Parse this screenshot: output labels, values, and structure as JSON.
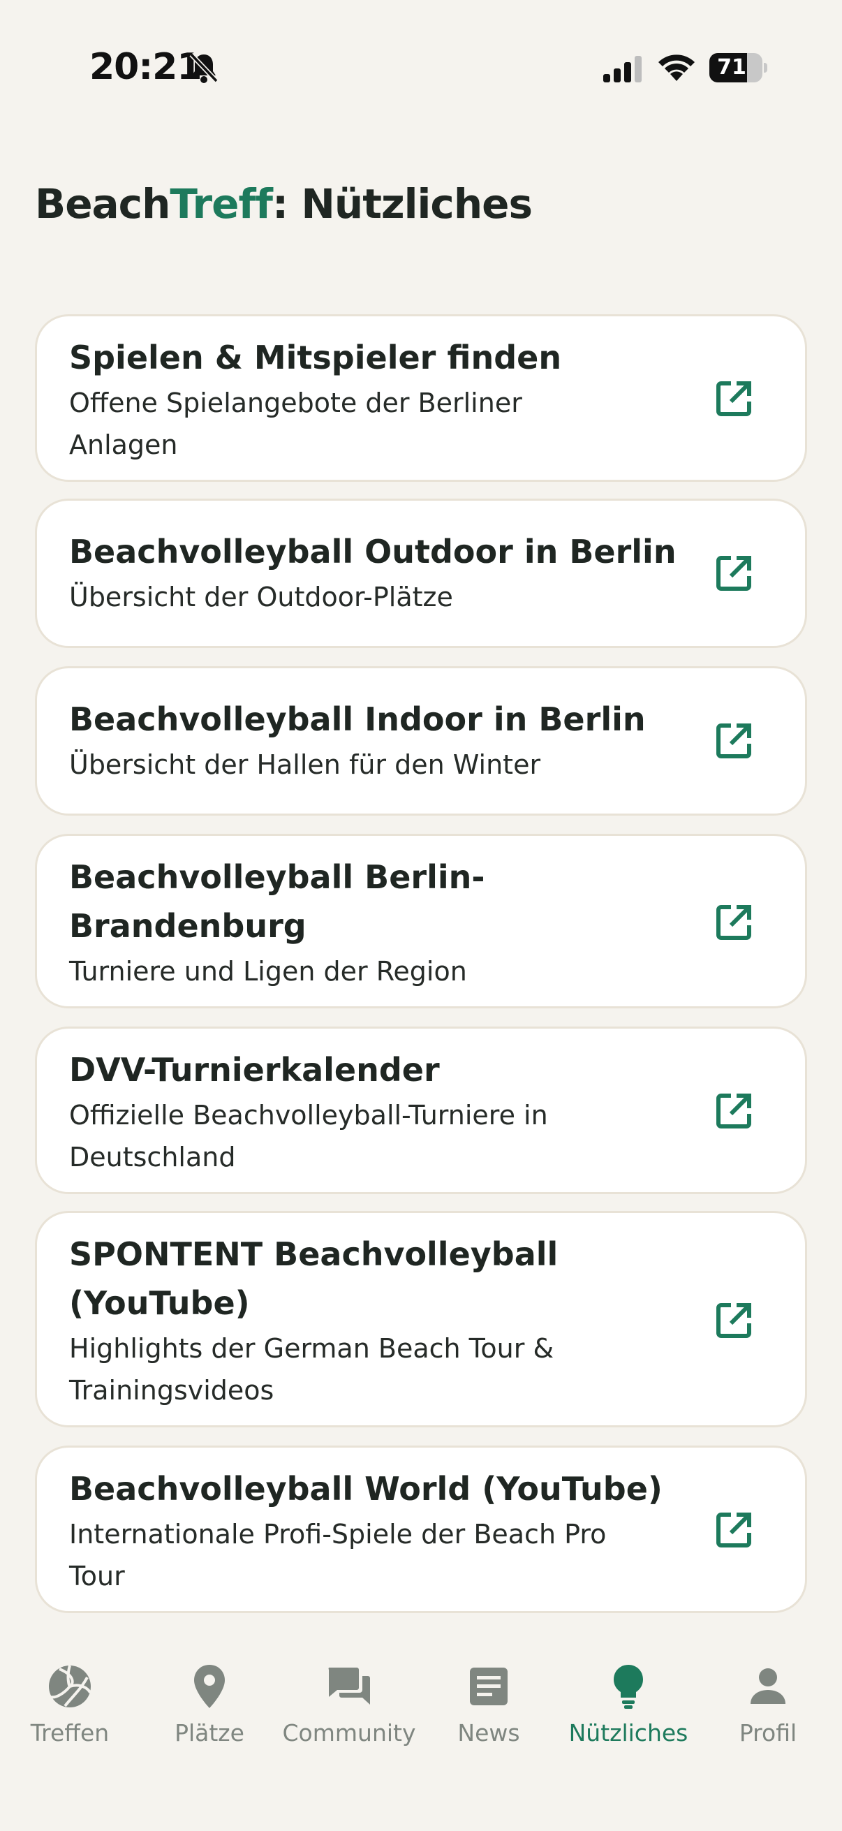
{
  "status": {
    "time": "20:21",
    "battery": "71",
    "battery_level": 0.71
  },
  "header": {
    "title_prefix": "Beach",
    "title_accent": "Treff",
    "title_rest": ": Nützliches"
  },
  "links": [
    {
      "title": "Spielen & Mitspieler finden",
      "subtitle_1": "Offene Spielangebote der Berliner",
      "subtitle_2": "Anlagen"
    },
    {
      "title": "Beachvolleyball Outdoor in Berlin",
      "subtitle_1": "Übersicht der Outdoor-Plätze"
    },
    {
      "title": "Beachvolleyball Indoor in Berlin",
      "subtitle_1": "Übersicht der Hallen für den Winter"
    },
    {
      "title_1": "Beachvolleyball Berlin-",
      "title_2": "Brandenburg",
      "subtitle_1": "Turniere und Ligen der Region"
    },
    {
      "title": "DVV-Turnierkalender",
      "subtitle_1": "Offizielle Beachvolleyball-Turniere in",
      "subtitle_2": "Deutschland"
    },
    {
      "title_1": "SPONTENT Beachvolleyball",
      "title_2": "(YouTube)",
      "subtitle_1": "Highlights der German Beach Tour &",
      "subtitle_2": "Trainingsvideos"
    },
    {
      "title": "Beachvolleyball World (YouTube)",
      "subtitle_1": "Internationale Profi-Spiele der Beach Pro",
      "subtitle_2": "Tour"
    }
  ],
  "tabs": [
    {
      "label": "Treffen",
      "icon": "volleyball-icon"
    },
    {
      "label": "Plätze",
      "icon": "map-pin-icon"
    },
    {
      "label": "Community",
      "icon": "chat-icon"
    },
    {
      "label": "News",
      "icon": "news-icon"
    },
    {
      "label": "Nützliches",
      "icon": "lightbulb-icon",
      "active": true
    },
    {
      "label": "Profil",
      "icon": "person-icon"
    }
  ],
  "colors": {
    "accent": "#1d7a5c",
    "background": "#f5f3ee",
    "card": "#ffffff",
    "inactive": "#7f8680"
  }
}
